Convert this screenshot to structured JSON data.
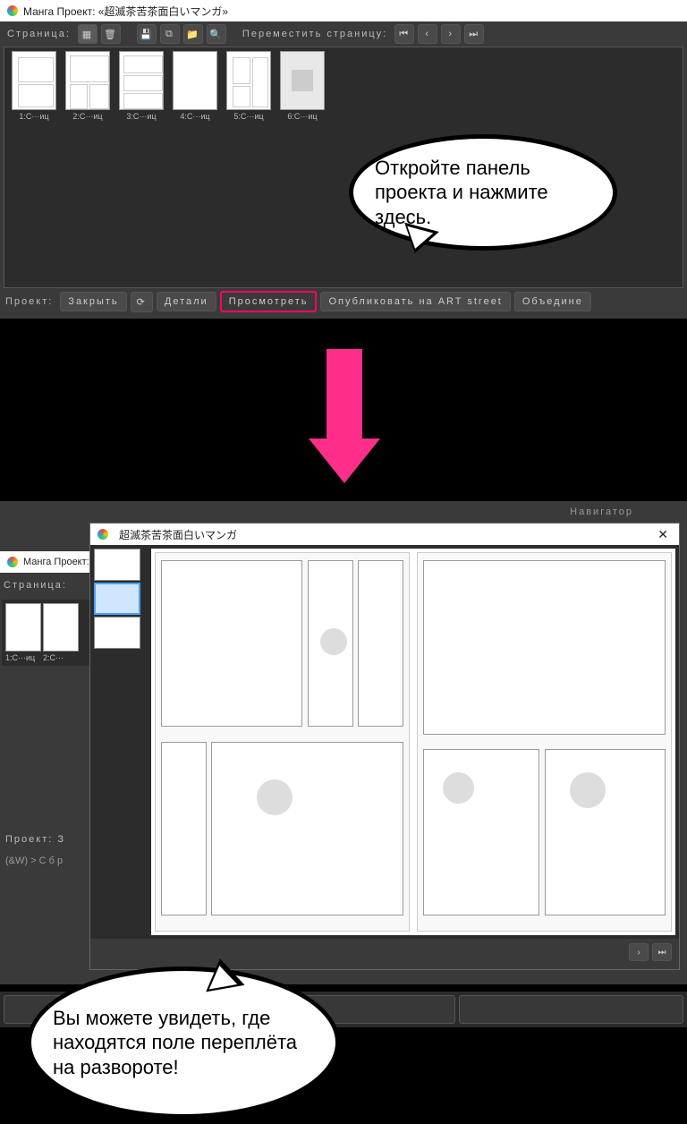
{
  "top": {
    "title": "Манга Проект: «超滅茶苦茶面白いマンガ»",
    "page_label": "Страница:",
    "move_label": "Переместить страницу:",
    "thumbs": [
      {
        "label": "1:С···иц"
      },
      {
        "label": "2:С···иц"
      },
      {
        "label": "3:С···иц"
      },
      {
        "label": "4:С···иц"
      },
      {
        "label": "5:С···иц"
      },
      {
        "label": "6:С···иц"
      }
    ],
    "bottom": {
      "project_label": "Проект:",
      "close": "Закрыть",
      "refresh": "⟳",
      "details": "Детали",
      "preview": "Просмотреть",
      "publish": "Опубликовать на ART street",
      "merge": "Объедине"
    }
  },
  "bubble1": "Откройте панель проекта и нажмите здесь.",
  "bubble2": "Вы можете увидеть, где находятся поле переплёта на развороте!",
  "bottom_window": {
    "navigator": "Навигатор",
    "left_title": "Манга Проект:",
    "page_label": "Страница:",
    "thumbs": [
      {
        "label": "1:С···иц"
      },
      {
        "label": "2:С···"
      }
    ],
    "project_label": "Проект:",
    "close_short": "З",
    "breadcrumb": "(&W) > С б р"
  },
  "preview": {
    "title": "超滅茶苦茶面白いマンガ",
    "close": "✕"
  },
  "icons": {
    "first": "⏮",
    "prev": "‹",
    "next": "›",
    "last": "⏭",
    "new": "▦",
    "delete": "🗑",
    "save": "💾",
    "copy": "⧉",
    "folder": "📁",
    "search": "🔍"
  }
}
